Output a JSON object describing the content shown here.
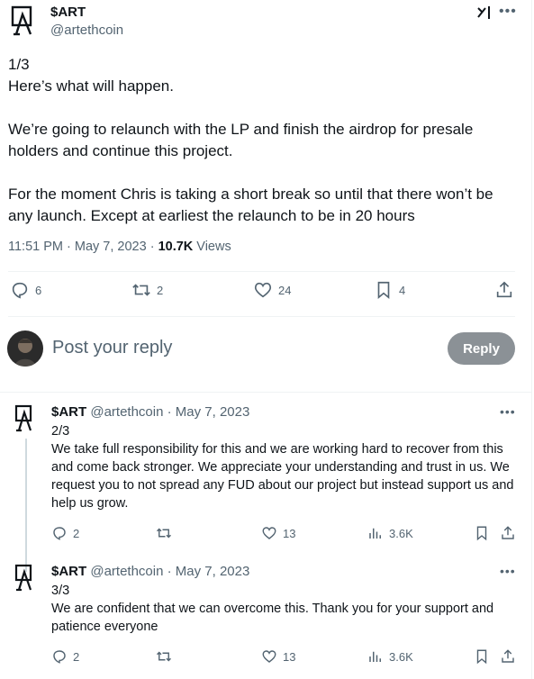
{
  "main_tweet": {
    "name": "$ART",
    "handle": "@artethcoin",
    "text": "1/3\nHere’s what will happen.\n\nWe’re going to relaunch with the LP and finish the airdrop for presale holders and continue this project.\n\nFor the moment Chris is taking a short break so until that there won’t be any launch. Except at earliest the relaunch to be in 20 hours",
    "timestamp": "11:51 PM · May 7, 2023 · ",
    "views_count": "10.7K",
    "views_label": " Views",
    "replies": "6",
    "reposts": "2",
    "likes": "24",
    "bookmarks": "4"
  },
  "reply_box": {
    "placeholder": "Post your reply",
    "button_label": "Reply"
  },
  "thread": [
    {
      "name": "$ART",
      "handle": "@artethcoin · May 7, 2023",
      "text": "2/3\nWe take full responsibility for this and we are working hard to recover from this and come back stronger. We appreciate your understanding and trust in us. We request you to not spread any FUD about our project but instead support us and help us grow.",
      "replies": "2",
      "likes": "13",
      "views": "3.6K"
    },
    {
      "name": "$ART",
      "handle": "@artethcoin · May 7, 2023",
      "text": "3/3\nWe are confident that we can overcome this. Thank you for your support and patience everyone",
      "replies": "2",
      "likes": "13",
      "views": "3.6K"
    }
  ],
  "icons": {
    "more": "more-icon",
    "grok": "grok-icon",
    "reply": "reply-icon",
    "repost": "repost-icon",
    "like": "like-icon",
    "bookmark": "bookmark-icon",
    "share": "share-icon",
    "views": "views-icon"
  },
  "colors": {
    "text_primary": "#0f1419",
    "text_secondary": "#536471",
    "reply_button": "#8b9196",
    "divider": "#eff3f4"
  }
}
